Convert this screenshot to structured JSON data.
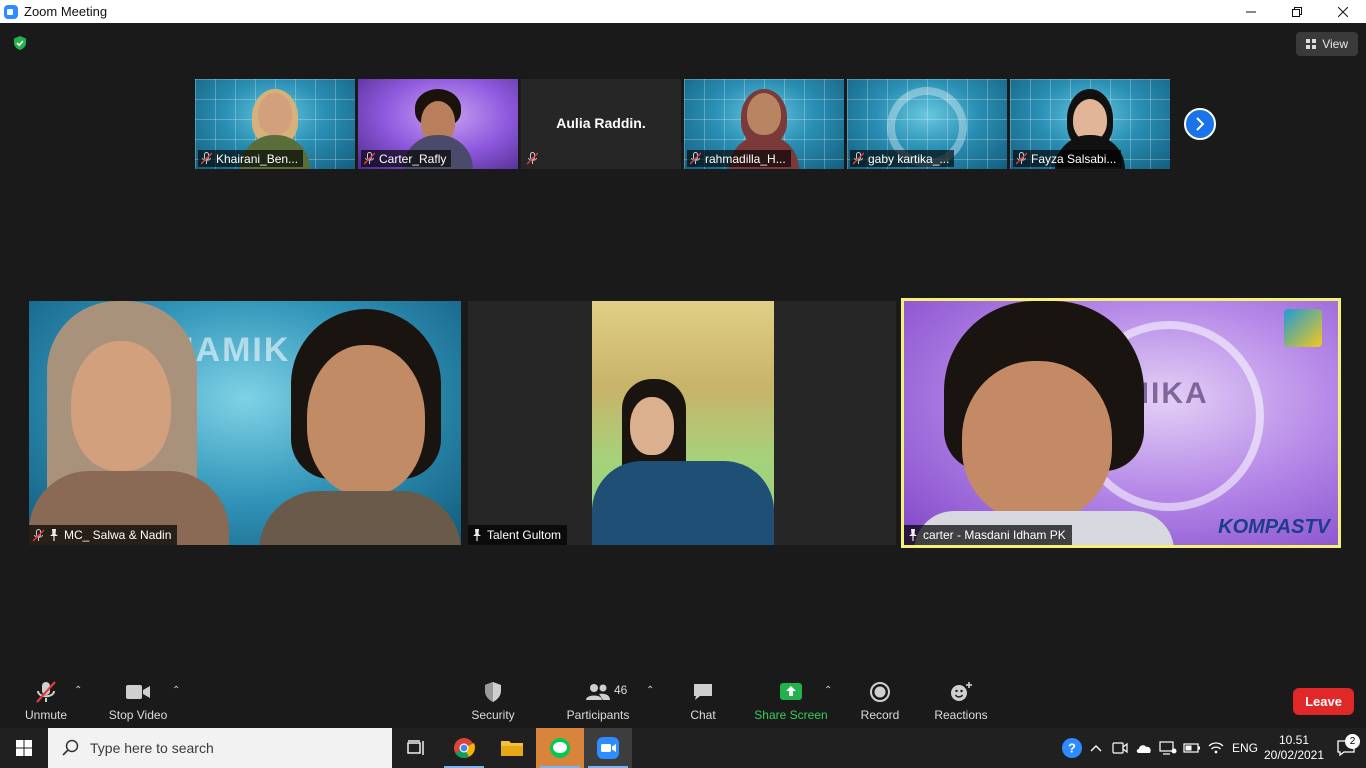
{
  "window": {
    "title": "Zoom Meeting",
    "controls": {
      "minimize": "—",
      "restore": "❐",
      "close": "✕"
    }
  },
  "top_right": {
    "view_label": "View"
  },
  "strip": [
    {
      "name": "Khairani_Ben...",
      "bg": "blue",
      "muted": true,
      "hijab": "#d6b17a",
      "body": "#5a6e3a"
    },
    {
      "name": "Carter_Rafly",
      "bg": "purple",
      "muted": true,
      "hijab": "",
      "body": "#4a4a6a"
    },
    {
      "name": "Aulia Raddin.",
      "bg": "dark",
      "muted": true,
      "video_off": true
    },
    {
      "name": "rahmadilla_H...",
      "bg": "blue",
      "muted": true,
      "hijab": "#7a3a3a",
      "body": "#7a3a3a"
    },
    {
      "name": "gaby kartika_...",
      "bg": "blue",
      "muted": true,
      "hijab": "",
      "body": "#2a4a6a",
      "empty": true
    },
    {
      "name": "Fayza Salsabi...",
      "bg": "blue",
      "muted": true,
      "hijab": "",
      "body": "#111111"
    }
  ],
  "main": [
    {
      "name": "MC_ Salwa & Nadin",
      "muted": true,
      "pinned": true
    },
    {
      "name": "Talent Gultom",
      "muted": false,
      "pinned": true
    },
    {
      "name": "carter - Masdani Idham PK",
      "muted": false,
      "pinned": true,
      "logo": "KOMPASTV",
      "bg_text": "MIKA"
    }
  ],
  "tile1_bg_text": "NAMIK",
  "toolbar": {
    "unmute": "Unmute",
    "stop_video": "Stop Video",
    "security": "Security",
    "participants": "Participants",
    "participants_count": "46",
    "chat": "Chat",
    "share_screen": "Share Screen",
    "record": "Record",
    "reactions": "Reactions",
    "leave": "Leave"
  },
  "taskbar": {
    "search_placeholder": "Type here to search",
    "language": "ENG",
    "time": "10.51",
    "date": "20/02/2021",
    "notifications": "2"
  },
  "colors": {
    "accent_blue": "#1a73e8",
    "leave_red": "#e02828",
    "share_green": "#34d058",
    "active_speaker": "#f4f07a"
  }
}
